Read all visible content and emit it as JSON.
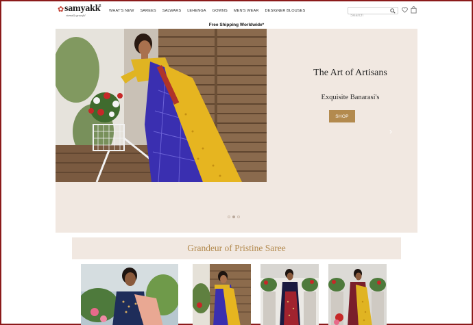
{
  "brand": {
    "logo_text": "samyakk",
    "logo_tagline": "eternally graceful",
    "logo_mark": "R"
  },
  "nav": {
    "items": [
      "WHAT'S NEW",
      "SAREES",
      "SALWARS",
      "LEHENGA",
      "GOWNS",
      "MEN'S WEAR",
      "DESIGNER BLOUSES"
    ]
  },
  "search": {
    "placeholder": "Search",
    "icon": "search-icon"
  },
  "header_icons": [
    "heart-icon",
    "shopping-bag-icon"
  ],
  "shipping_banner": "Free Shipping Worldwide*",
  "hero": {
    "title": "The Art of Artisans",
    "subtitle": "Exquisite Banarasi's",
    "button_label": "SHOP",
    "next_arrow": "›",
    "slides": 3,
    "active_slide": 1
  },
  "section": {
    "title": "Grandeur of Pristine Saree"
  },
  "colors": {
    "accent_gold": "#b38a4e",
    "banner_bg": "#f1e8e1",
    "page_border": "#8b1a1a",
    "logo_red": "#c0392b"
  }
}
